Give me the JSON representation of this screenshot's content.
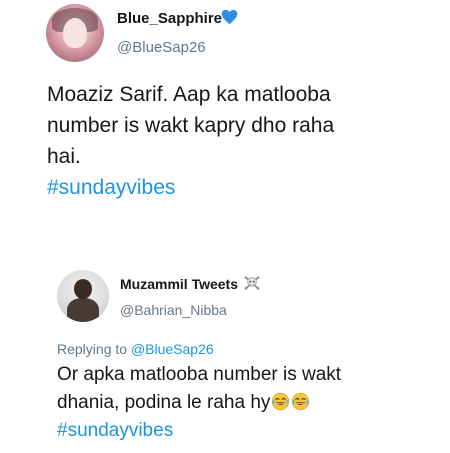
{
  "tweet": {
    "author_name": "Blue_Sapphire",
    "author_badge": "blue-heart-icon",
    "handle": "@BlueSap26",
    "text_lines": [
      "Moaziz Sarif. Aap ka matlooba",
      "number is wakt kapry dho raha",
      "hai."
    ],
    "hashtag": "#sundayvibes"
  },
  "reply": {
    "author_name": "Muzammil Tweets",
    "author_badge": "skull-crossbones-icon",
    "handle": "@Bahrian_Nibba",
    "replying_to_prefix": "Replying to",
    "replying_to_handle": "@BlueSap26",
    "text_lines": [
      "Or apka matlooba number is wakt",
      "dhania, podina le raha hy"
    ],
    "emojis": [
      "tears-of-joy-icon",
      "tears-of-joy-icon"
    ],
    "hashtag": "#sundayvibes"
  },
  "colors": {
    "link": "#1b95e0",
    "secondary_text": "#657786",
    "primary_text": "#14171a",
    "badge_heart": "#2d8ee6"
  }
}
